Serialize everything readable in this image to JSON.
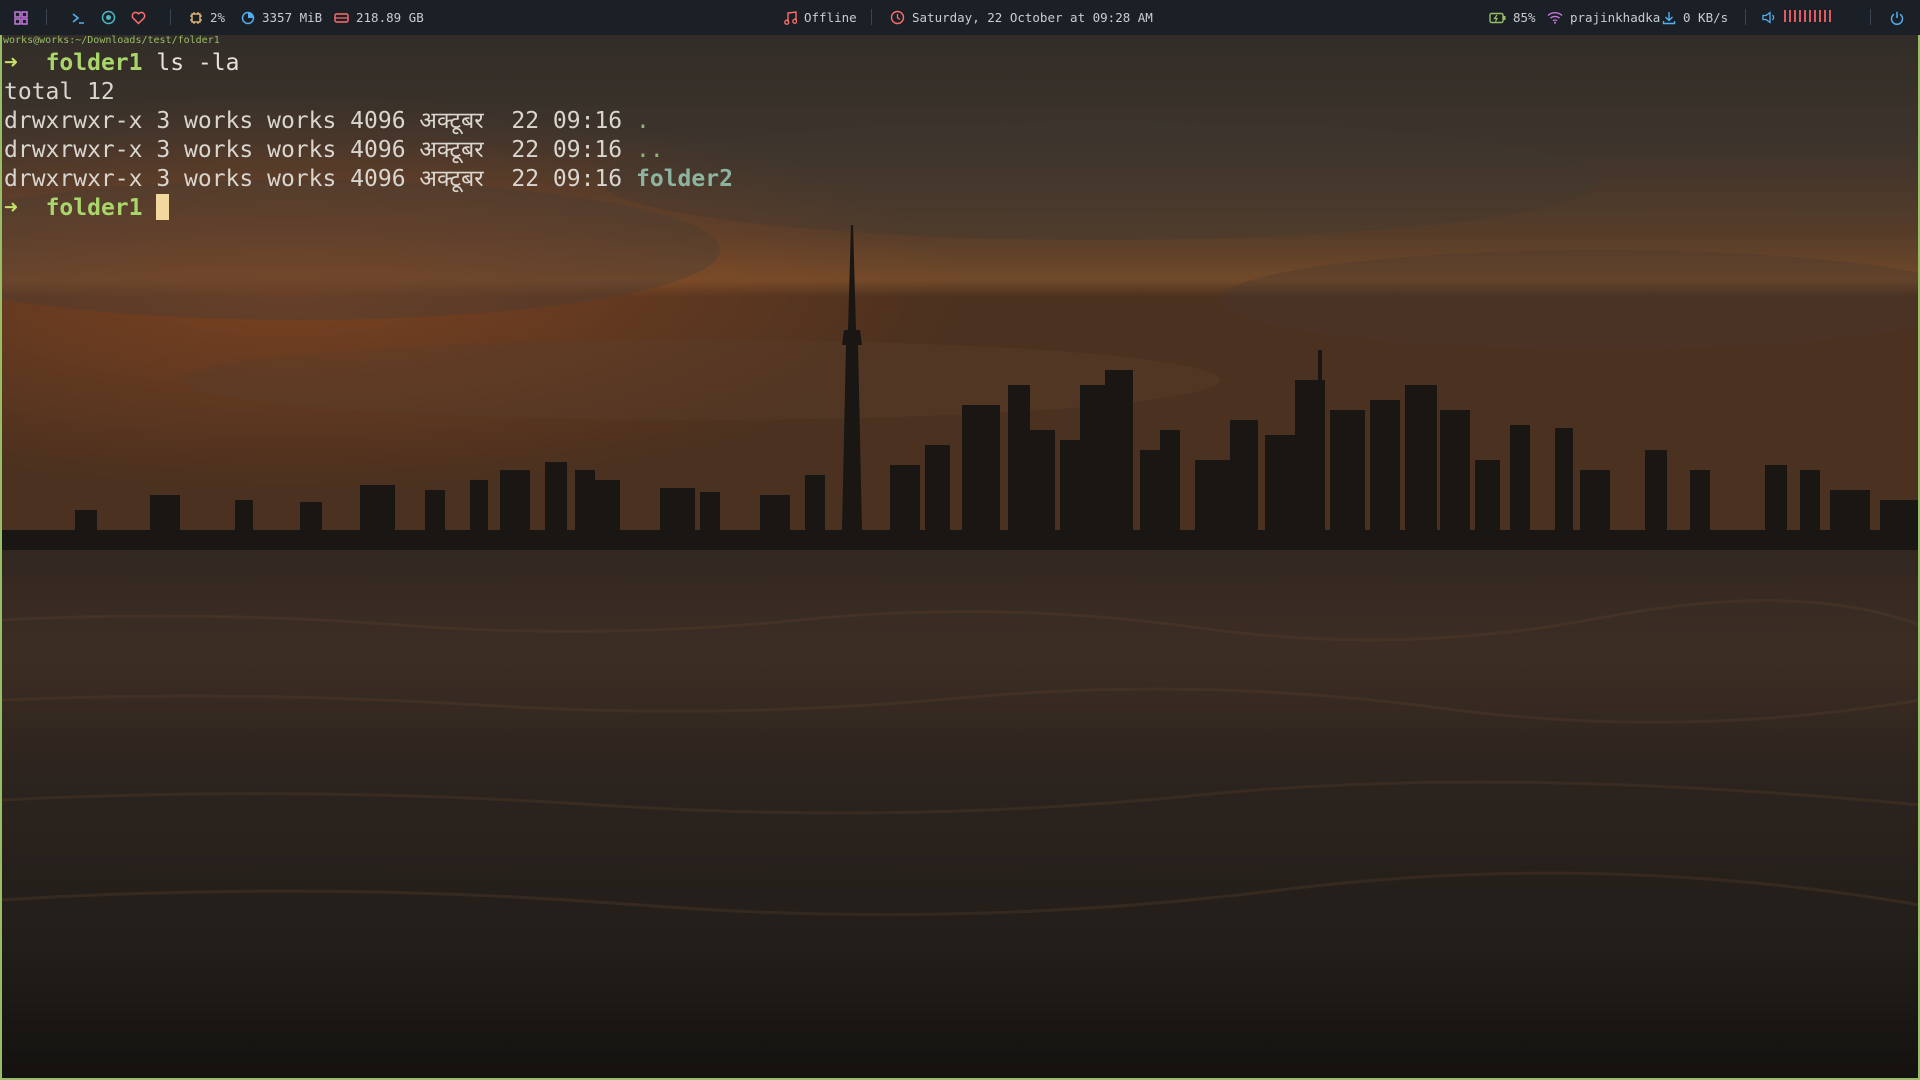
{
  "topbar": {
    "left": {
      "cpu": "2%",
      "memory": "3357 MiB",
      "disk": "218.89 GB"
    },
    "center": {
      "music_status": "Offline",
      "datetime": "Saturday, 22 October at 09:28 AM"
    },
    "right": {
      "battery": "85%",
      "wifi_name": "prajinkhadka",
      "net_speed": "0 KB/s",
      "volume_level_bars": 10
    },
    "colors": {
      "accent_green": "#98be65",
      "volume_red": "#e05a66",
      "memory_blue": "#51afef",
      "cpu_yellow": "#ecbe7b",
      "wifi_purple": "#c678dd"
    }
  },
  "terminal": {
    "title": "works@works:~/Downloads/test/folder1",
    "lines": [
      {
        "arrow": "➜",
        "dir": "folder1",
        "command": "ls -la"
      },
      {
        "text": "total 12"
      },
      {
        "perms": "drwxrwxr-x 3 works works 4096 ",
        "month": "अक्टूबर",
        "time": "  22 09:16 ",
        "name": "."
      },
      {
        "perms": "drwxrwxr-x 3 works works 4096 ",
        "month": "अक्टूबर",
        "time": "  22 09:16 ",
        "name": ".."
      },
      {
        "perms": "drwxrwxr-x 3 works works 4096 ",
        "month": "अक्टूबर",
        "time": "  22 09:16 ",
        "name": "folder2"
      },
      {
        "arrow": "➜",
        "dir": "folder1"
      }
    ]
  }
}
